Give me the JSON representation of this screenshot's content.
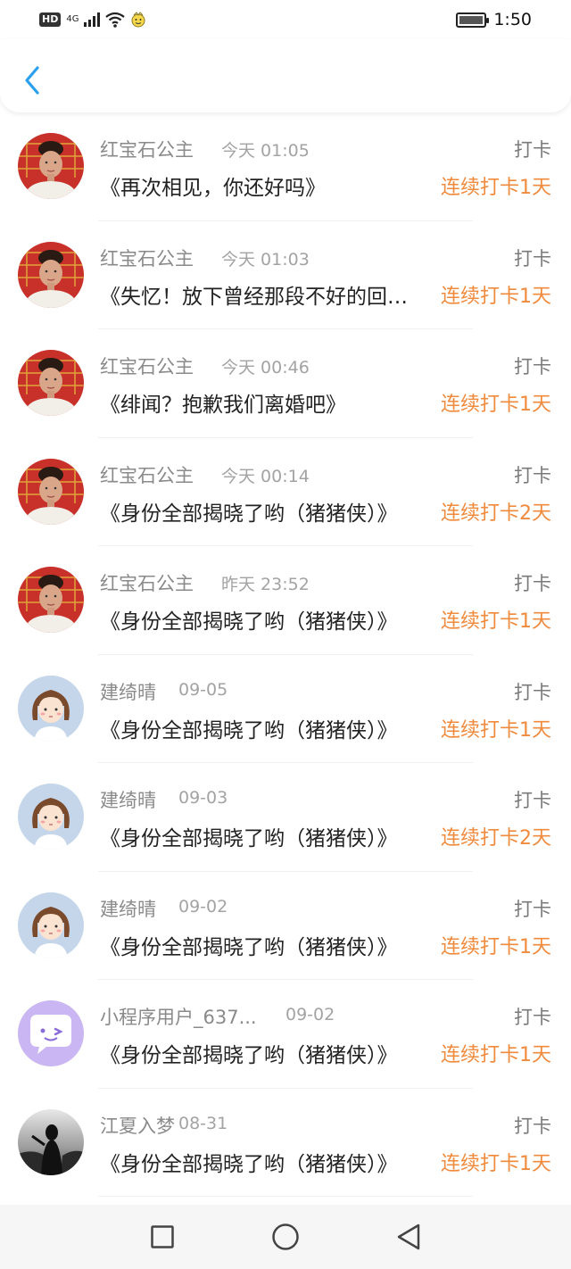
{
  "status_bar": {
    "hd": "HD",
    "network": "4G",
    "time": "1:50"
  },
  "colors": {
    "accent_back": "#2aa0ee",
    "streak": "#f08a3c",
    "nav_bg": "#f6f6f6"
  },
  "header": {
    "back_icon": "chevron-left-icon"
  },
  "rows": [
    {
      "name": "红宝石公主",
      "time": "今天 01:05",
      "title": "《再次相见，你还好吗》",
      "tag": "打卡",
      "streak": "连续打卡1天",
      "avatar": "portrait-woman"
    },
    {
      "name": "红宝石公主",
      "time": "今天 01:03",
      "title": "《失忆！放下曾经那段不好的回忆》",
      "tag": "打卡",
      "streak": "连续打卡1天",
      "avatar": "portrait-woman"
    },
    {
      "name": "红宝石公主",
      "time": "今天 00:46",
      "title": "《绯闻？抱歉我们离婚吧》",
      "tag": "打卡",
      "streak": "连续打卡1天",
      "avatar": "portrait-woman"
    },
    {
      "name": "红宝石公主",
      "time": "今天 00:14",
      "title": "《身份全部揭晓了哟（猪猪侠）》",
      "tag": "打卡",
      "streak": "连续打卡2天",
      "avatar": "portrait-woman"
    },
    {
      "name": "红宝石公主",
      "time": "昨天 23:52",
      "title": "《身份全部揭晓了哟（猪猪侠）》",
      "tag": "打卡",
      "streak": "连续打卡1天",
      "avatar": "portrait-woman"
    },
    {
      "name": "建绮晴",
      "time": "09-05",
      "title": "《身份全部揭晓了哟（猪猪侠）》",
      "tag": "打卡",
      "streak": "连续打卡1天",
      "avatar": "cartoon-girl"
    },
    {
      "name": "建绮晴",
      "time": "09-03",
      "title": "《身份全部揭晓了哟（猪猪侠）》",
      "tag": "打卡",
      "streak": "连续打卡2天",
      "avatar": "cartoon-girl"
    },
    {
      "name": "建绮晴",
      "time": "09-02",
      "title": "《身份全部揭晓了哟（猪猪侠）》",
      "tag": "打卡",
      "streak": "连续打卡1天",
      "avatar": "cartoon-girl"
    },
    {
      "name": "小程序用户_637...",
      "time": "09-02",
      "title": "《身份全部揭晓了哟（猪猪侠）》",
      "tag": "打卡",
      "streak": "连续打卡1天",
      "avatar": "wink-face"
    },
    {
      "name": "江夏入梦",
      "time": "08-31",
      "title": "《身份全部揭晓了哟（猪猪侠）》",
      "tag": "打卡",
      "streak": "连续打卡1天",
      "avatar": "silhouette-photo"
    }
  ],
  "nav_bar": {
    "recent_icon": "square-icon",
    "home_icon": "circle-icon",
    "back_icon": "triangle-back-icon"
  }
}
